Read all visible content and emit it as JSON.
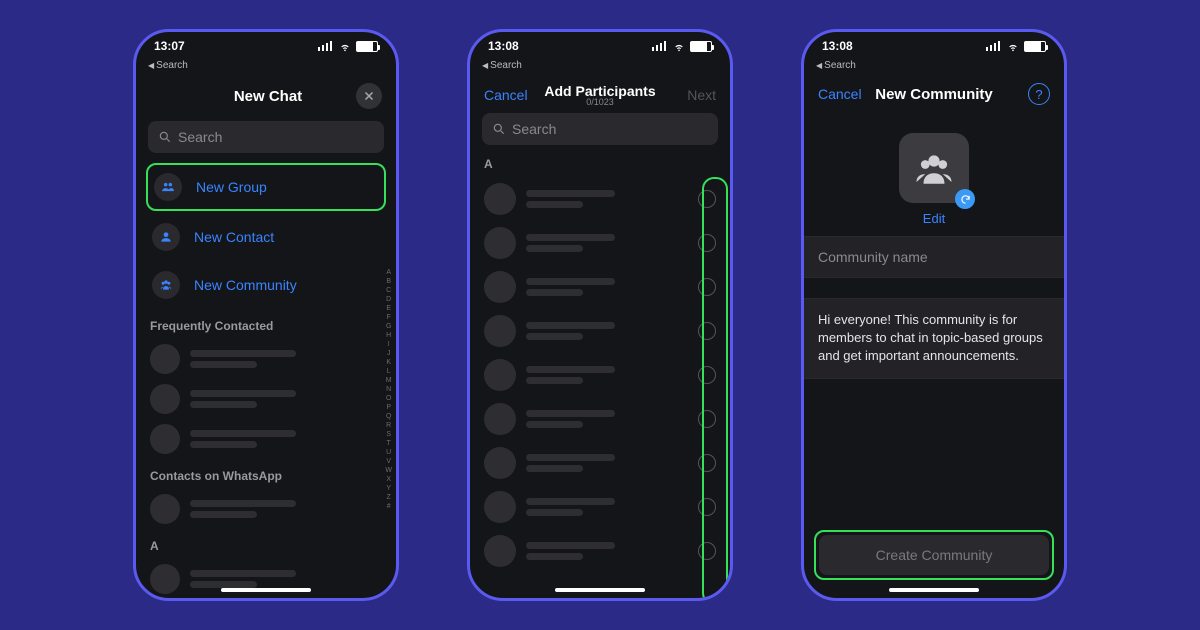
{
  "status_time_1": "13:07",
  "status_time_2": "13:08",
  "status_time_3": "13:08",
  "back_search": "Search",
  "screen1": {
    "title": "New Chat",
    "search_placeholder": "Search",
    "new_group": "New Group",
    "new_contact": "New Contact",
    "new_community": "New Community",
    "freq_contacted": "Frequently Contacted",
    "contacts_on": "Contacts on WhatsApp",
    "section_a": "A"
  },
  "screen2": {
    "cancel": "Cancel",
    "title": "Add Participants",
    "subtitle": "0/1023",
    "next": "Next",
    "search_placeholder": "Search",
    "section_a": "A"
  },
  "screen3": {
    "cancel": "Cancel",
    "title": "New Community",
    "edit": "Edit",
    "name_placeholder": "Community name",
    "description": "Hi everyone! This community is for members to chat in topic-based groups and get important announcements.",
    "create": "Create Community"
  },
  "alpha_index": [
    "A",
    "B",
    "C",
    "D",
    "E",
    "F",
    "G",
    "H",
    "I",
    "J",
    "K",
    "L",
    "M",
    "N",
    "O",
    "P",
    "Q",
    "R",
    "S",
    "T",
    "U",
    "V",
    "W",
    "X",
    "Y",
    "Z",
    "#"
  ]
}
